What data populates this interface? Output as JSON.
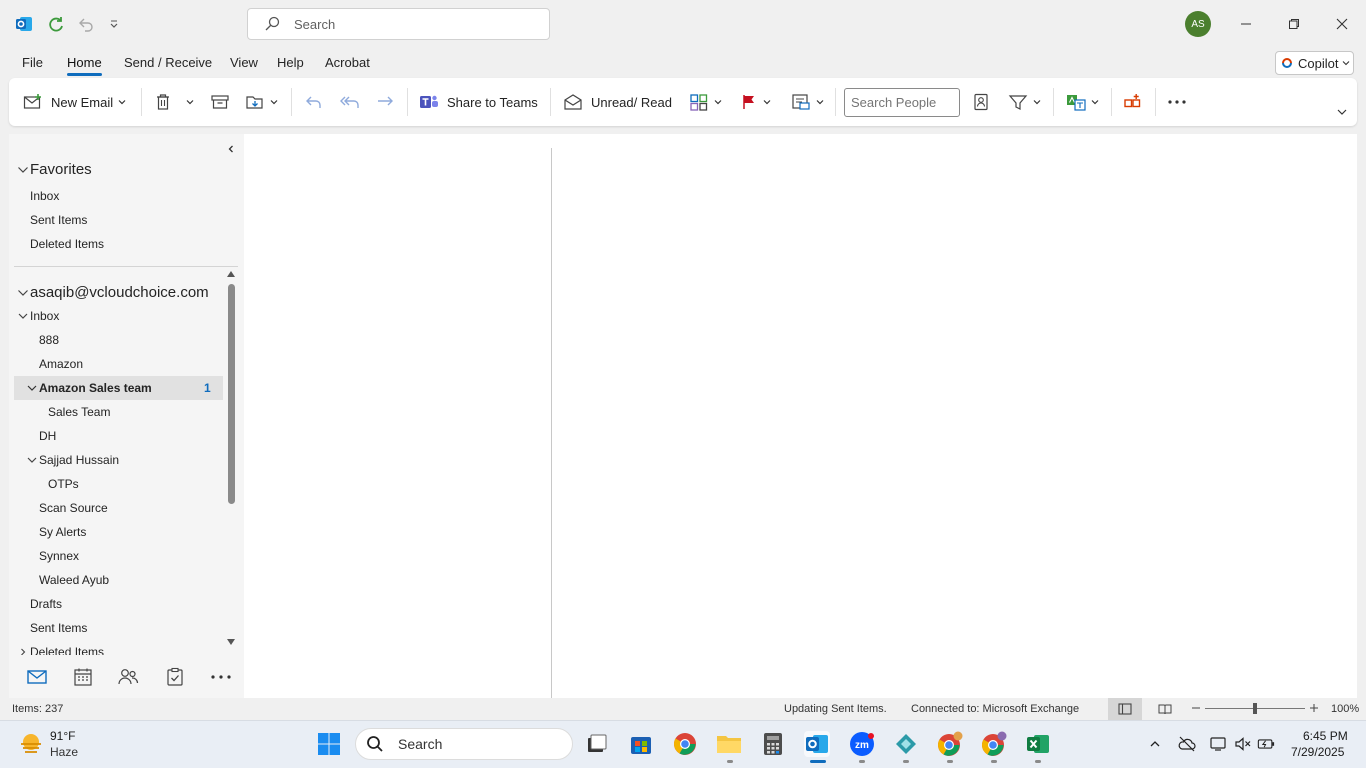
{
  "titlebar": {
    "search_placeholder": "Search",
    "avatar_initials": "AS"
  },
  "menu": {
    "tabs": [
      "File",
      "Home",
      "Send / Receive",
      "View",
      "Help",
      "Acrobat"
    ],
    "active_tab": "Home",
    "copilot_label": "Copilot"
  },
  "ribbon": {
    "new_email": "New Email",
    "share_to_teams": "Share to Teams",
    "unread_read": "Unread/ Read",
    "search_people_placeholder": "Search People"
  },
  "folders": {
    "favorites_header": "Favorites",
    "favorites": [
      "Inbox",
      "Sent Items",
      "Deleted Items"
    ],
    "account": "asaqib@vcloudchoice.com",
    "inbox": "Inbox",
    "inbox_children": [
      "888",
      "Amazon"
    ],
    "selected_folder": "Amazon Sales team",
    "selected_unread": "1",
    "selected_children": [
      "Sales Team"
    ],
    "dh": "DH",
    "sajjad": "Sajjad Hussain",
    "sajjad_children": [
      "OTPs"
    ],
    "more_inbox": [
      "Scan Source",
      "Sy Alerts",
      "Synnex",
      "Waleed Ayub"
    ],
    "root_folders": [
      "Drafts",
      "Sent Items",
      "Deleted Items"
    ]
  },
  "statusbar": {
    "items": "Items: 237",
    "updating": "Updating Sent Items.",
    "connection": "Connected to: Microsoft Exchange",
    "zoom": "100%",
    "zoom_fraction": 0.5
  },
  "taskbar": {
    "weather_temp": "91°F",
    "weather_desc": "Haze",
    "search": "Search",
    "time": "6:45 PM",
    "date": "7/29/2025"
  },
  "colors": {
    "accent": "#0f6cbd",
    "flag": "#c50f1f",
    "avatar": "#4b7f2e",
    "new_group": "#d83b01"
  }
}
